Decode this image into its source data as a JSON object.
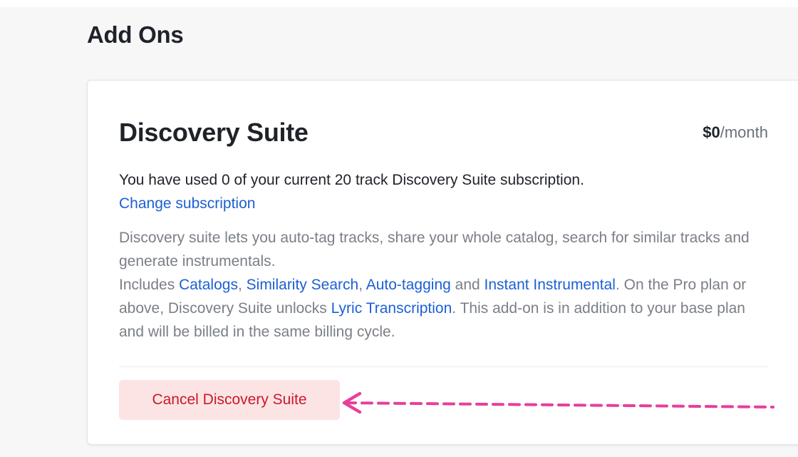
{
  "section": {
    "title": "Add Ons"
  },
  "addon": {
    "title": "Discovery Suite",
    "price_amount": "$0",
    "price_unit": "/month",
    "usage_text": "You have used 0 of your current 20 track Discovery Suite subscription.",
    "change_subscription_link": "Change subscription",
    "description_intro": "Discovery suite lets you auto-tag tracks, share your whole catalog, search for similar tracks and generate instrumentals.",
    "includes_prefix": "Includes",
    "feature_links": [
      "Catalogs",
      "Similarity Search",
      "Auto-tagging",
      "Instant Instrumental"
    ],
    "sep_comma": ",",
    "sep_and": "and",
    "pro_plan_text": ". On the Pro plan or above, Discovery Suite unlocks",
    "lyric_link": "Lyric Transcription",
    "billing_text": ". This add-on is in addition to your base plan and will be billed in the same billing cycle.",
    "cancel_button": "Cancel Discovery Suite"
  },
  "colors": {
    "link": "#1d5fd6",
    "cancel_text": "#c8192e",
    "cancel_bg": "#fde4e4",
    "annotation_arrow": "#e83e9c"
  }
}
